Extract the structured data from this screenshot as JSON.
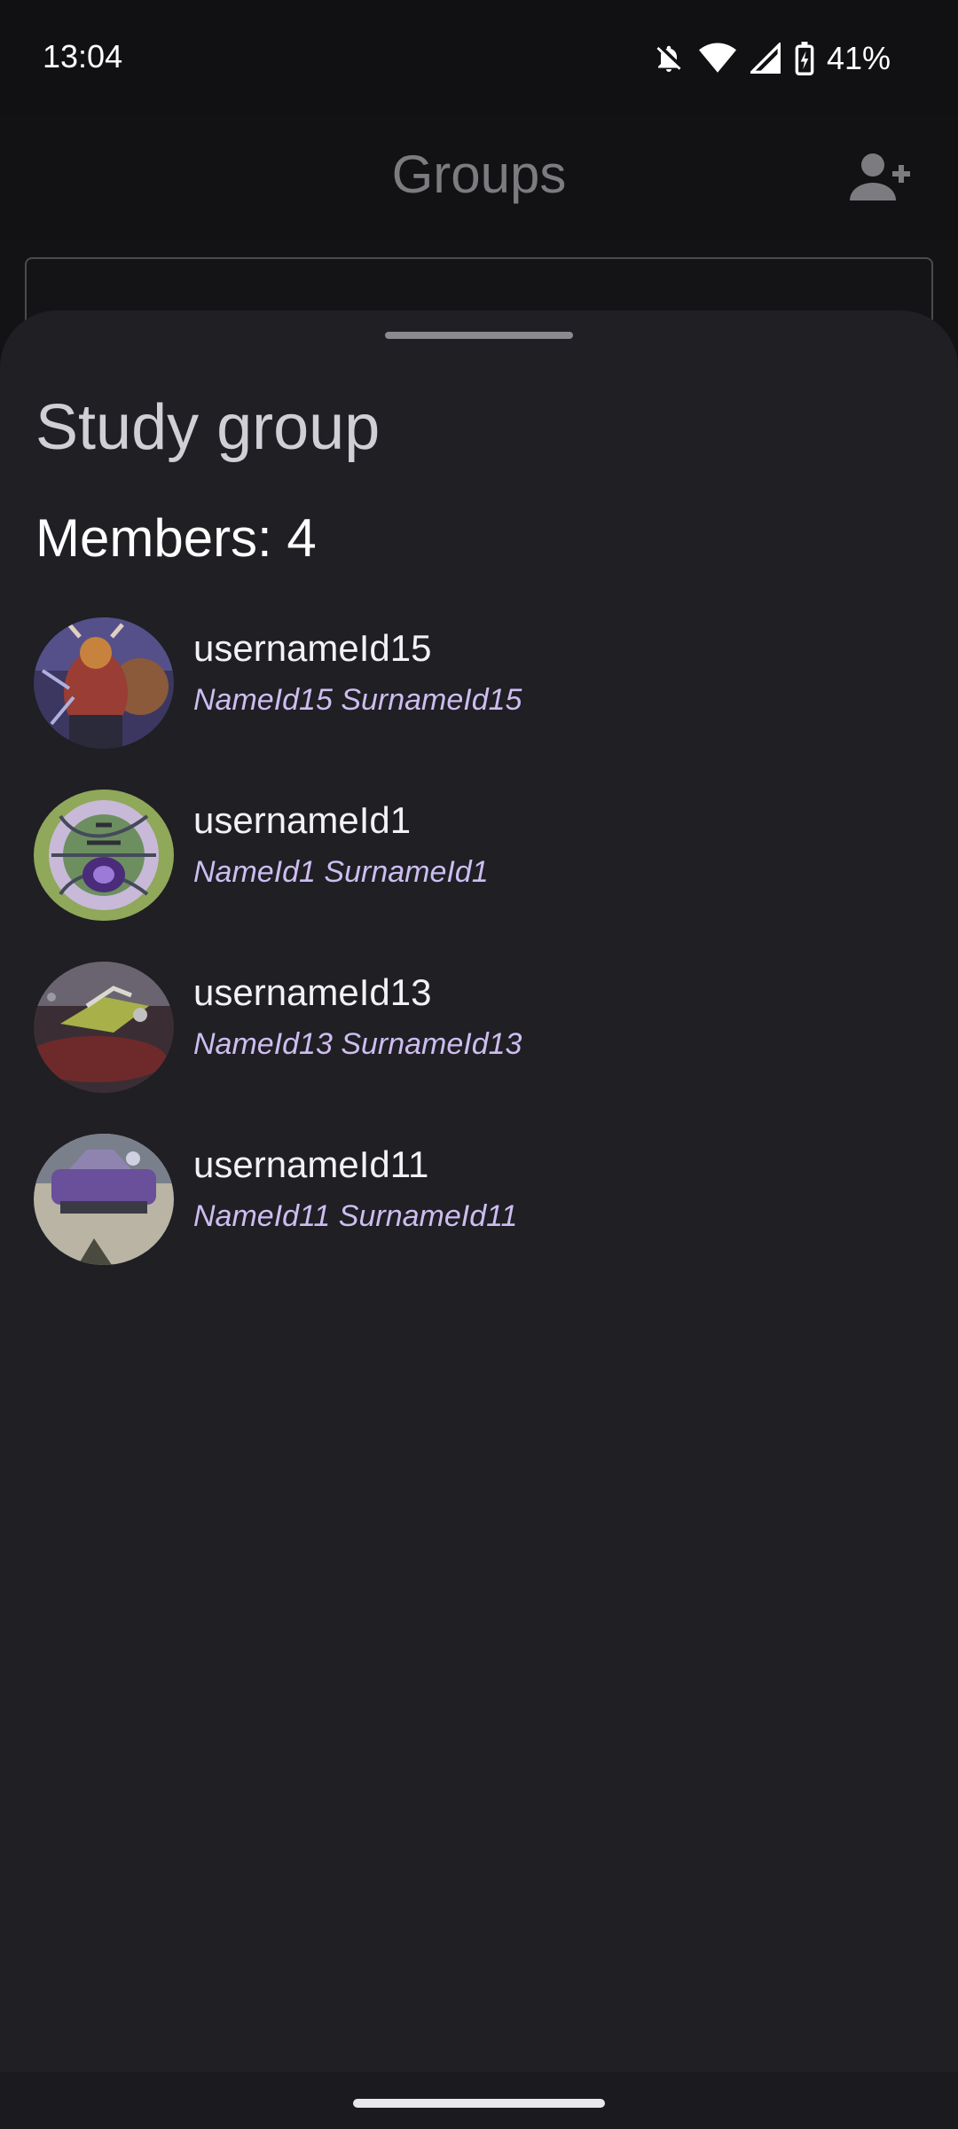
{
  "status_bar": {
    "time": "13:04",
    "battery": "41%",
    "icons": [
      "bell-off-icon",
      "wifi-icon",
      "signal-icon",
      "battery-charging-icon"
    ]
  },
  "app_bar": {
    "title": "Groups",
    "action_icon": "person-add-icon"
  },
  "sheet": {
    "group_name": "Study group",
    "members_label": "Members: 4",
    "members": [
      {
        "username": "usernameId15",
        "full_name": "NameId15 SurnameId15"
      },
      {
        "username": "usernameId1",
        "full_name": "NameId1 SurnameId1"
      },
      {
        "username": "usernameId13",
        "full_name": "NameId13 SurnameId13"
      },
      {
        "username": "usernameId11",
        "full_name": "NameId11 SurnameId11"
      }
    ]
  },
  "colors": {
    "background": "#131316",
    "sheet": "#1f1f24",
    "full_name_accent": "#cdbdf0",
    "app_title_dimmed": "#7c7c80"
  }
}
